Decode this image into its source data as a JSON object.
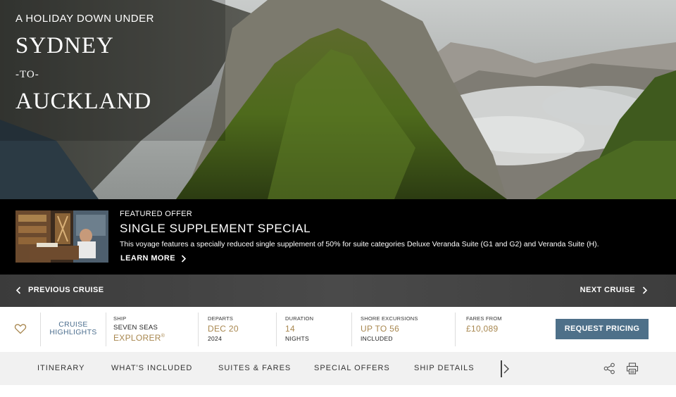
{
  "hero": {
    "kicker": "A HOLIDAY DOWN UNDER",
    "origin": "SYDNEY",
    "connector": "-TO-",
    "destination": "AUCKLAND"
  },
  "offer": {
    "kicker": "FEATURED OFFER",
    "title": "SINGLE SUPPLEMENT SPECIAL",
    "description": "This voyage features a specially reduced single supplement of 50% for suite categories Deluxe Veranda Suite (G1 and G2) and Veranda Suite (H).",
    "link_label": "LEARN MORE"
  },
  "pager": {
    "prev_label": "PREVIOUS CRUISE",
    "next_label": "NEXT CRUISE"
  },
  "summary": {
    "highlights_line1": "CRUISE",
    "highlights_line2": "HIGHLIGHTS",
    "ship_label": "SHIP",
    "ship_line1": "SEVEN SEAS",
    "ship_line2": "EXPLORER",
    "ship_mark": "®",
    "departs_label": "DEPARTS",
    "departs_value": "DEC 20",
    "departs_year": "2024",
    "duration_label": "DURATION",
    "duration_value": "14",
    "duration_unit": "NIGHTS",
    "excursions_label": "SHORE EXCURSIONS",
    "excursions_value": "UP TO 56",
    "excursions_sub": "INCLUDED",
    "fares_label": "FARES FROM",
    "fares_value": "£10,089",
    "pricing_button": "REQUEST PRICING"
  },
  "tabs": [
    {
      "label": "ITINERARY"
    },
    {
      "label": "WHAT'S INCLUDED"
    },
    {
      "label": "SUITES & FARES"
    },
    {
      "label": "SPECIAL OFFERS"
    },
    {
      "label": "SHIP DETAILS"
    }
  ],
  "colors": {
    "accent_blue": "#4e7089",
    "gold": "#a8874f"
  },
  "icons": [
    "heart-icon",
    "chevron-left-icon",
    "chevron-right-icon",
    "share-icon",
    "print-icon"
  ]
}
